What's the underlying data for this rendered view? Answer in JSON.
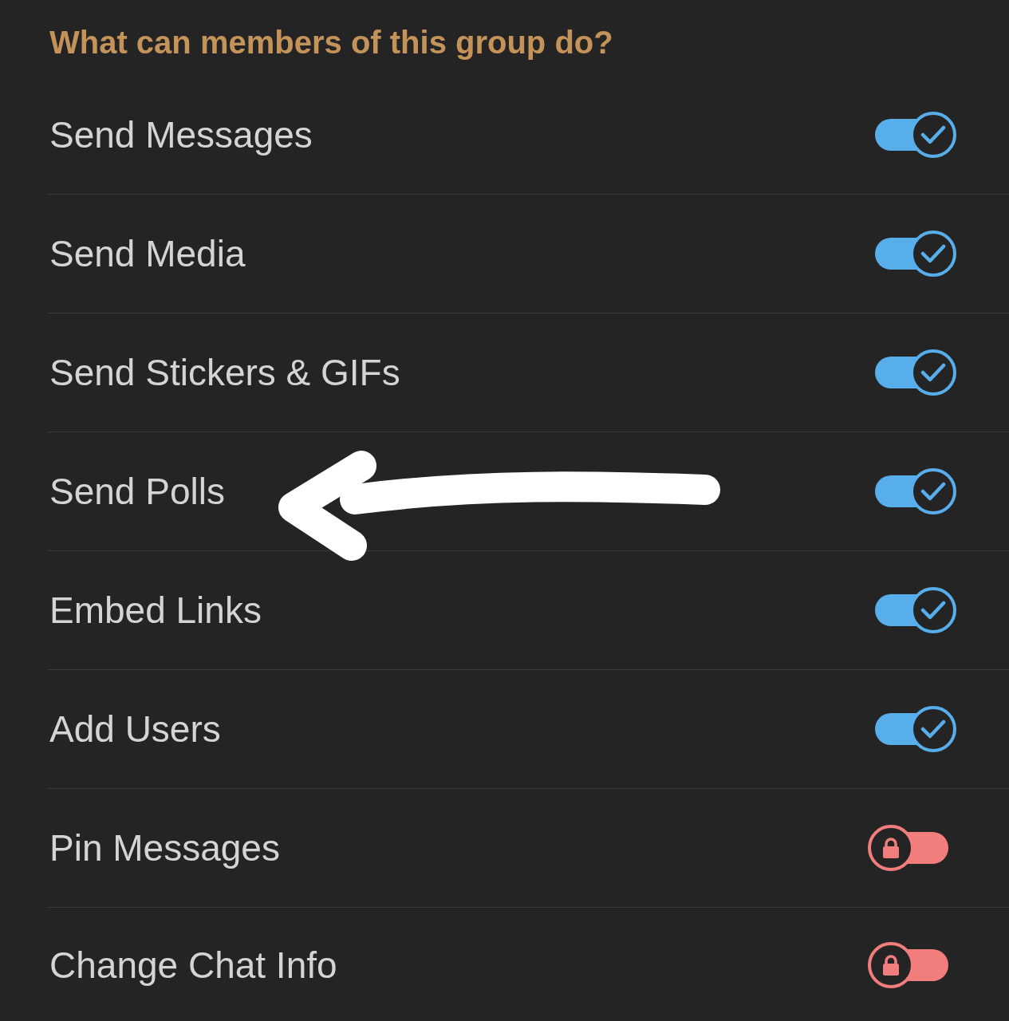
{
  "section_title": "What can members of this group do?",
  "permissions": [
    {
      "label": "Send Messages",
      "on": true,
      "annotated": false
    },
    {
      "label": "Send Media",
      "on": true,
      "annotated": false
    },
    {
      "label": "Send Stickers & GIFs",
      "on": true,
      "annotated": false
    },
    {
      "label": "Send Polls",
      "on": true,
      "annotated": true
    },
    {
      "label": "Embed Links",
      "on": true,
      "annotated": false
    },
    {
      "label": "Add Users",
      "on": true,
      "annotated": false
    },
    {
      "label": "Pin Messages",
      "on": false,
      "annotated": false
    },
    {
      "label": "Change Chat Info",
      "on": false,
      "annotated": false
    }
  ]
}
